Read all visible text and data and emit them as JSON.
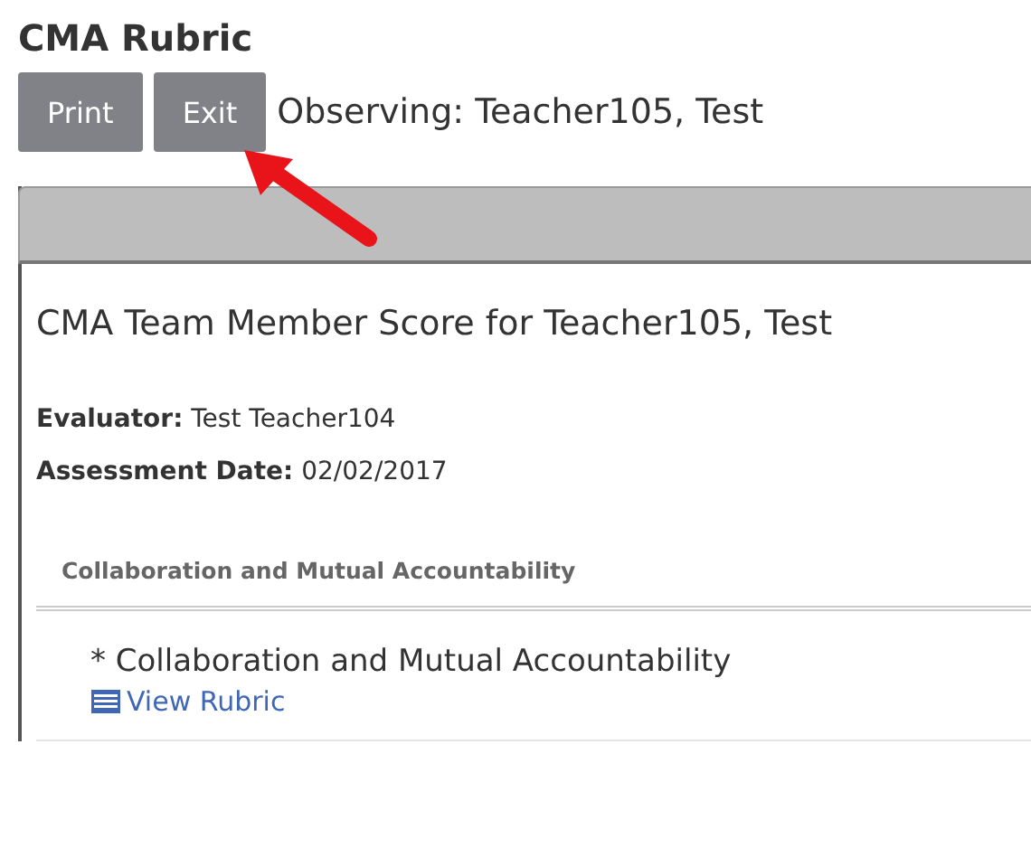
{
  "page_title": "CMA Rubric",
  "buttons": [
    {
      "label": "Print"
    },
    {
      "label": "Exit"
    }
  ],
  "observing": "Observing: Teacher105, Test",
  "panel": {
    "score_title": "CMA Team Member Score for Teacher105, Test",
    "details": [
      {
        "label": "Evaluator:",
        "value": "Test Teacher104"
      },
      {
        "label": "Assessment Date:",
        "value": "02/02/2017"
      }
    ],
    "section_header": "Collaboration and Mutual Accountability",
    "items": [
      {
        "title": "* Collaboration and Mutual Accountability",
        "link": "View Rubric"
      }
    ]
  }
}
